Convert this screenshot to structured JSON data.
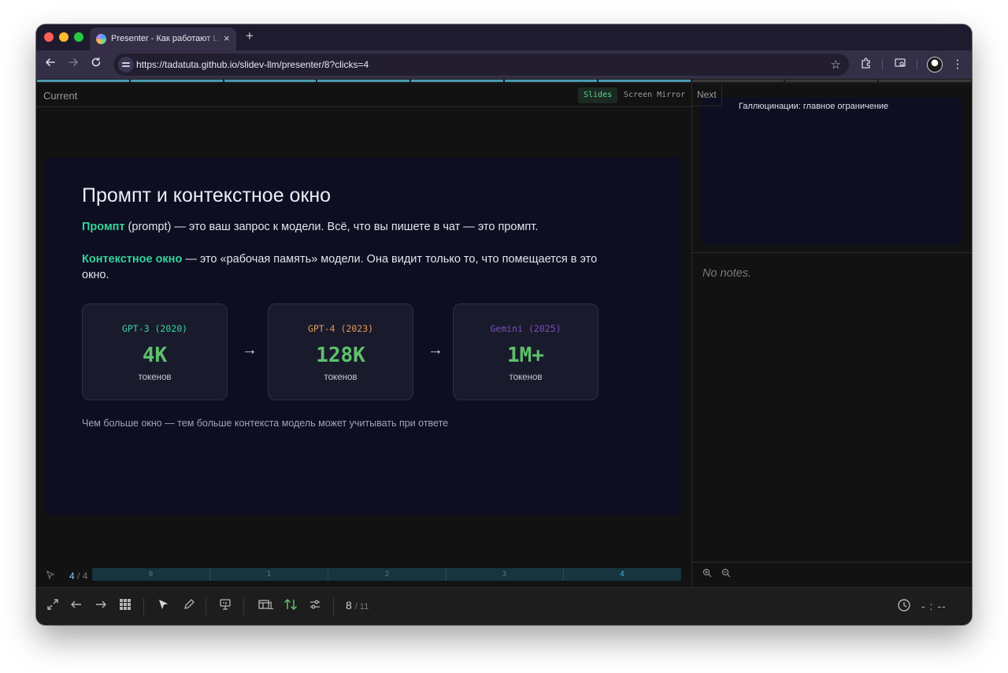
{
  "browser": {
    "tab": {
      "title": "Presenter - Как работают LLM",
      "close": "×"
    },
    "new_tab": "+",
    "url": "https://tadatuta.github.io/slidev-llm/presenter/8?clicks=4",
    "icons": [
      "back-icon",
      "forward-icon",
      "reload-icon",
      "site-info-icon",
      "star-icon",
      "extensions-icon",
      "cast-icon",
      "profile-avatar",
      "menu-icon"
    ]
  },
  "progress": {
    "completed_segments": 7,
    "total_segments": 10
  },
  "presenter": {
    "current_label": "Current",
    "tabs": {
      "slides": "Slides",
      "mirror": "Screen Mirror"
    },
    "next_label": "Next",
    "notes": "No notes.",
    "clicks": {
      "current": "4",
      "total": "/ 4",
      "steps": [
        "0",
        "1",
        "2",
        "3",
        "4"
      ],
      "active_step": 4
    }
  },
  "slide": {
    "title": "Промпт и контекстное окно",
    "prompt_term": "Промпт",
    "prompt_text": " (prompt) — это ваш запрос к модели. Всё, что вы пишете в чат — это промпт.",
    "context_term": "Контекстное окно",
    "context_text": " — это «рабочая память» модели. Она видит только то, что помещается в это окно.",
    "cards": [
      {
        "model": "GPT-3 (2020)",
        "value": "4K",
        "unit": "токенов",
        "color": "#35d49a"
      },
      {
        "model": "GPT-4 (2023)",
        "value": "128K",
        "unit": "токенов",
        "color": "#e19a52"
      },
      {
        "model": "Gemini (2025)",
        "value": "1M+",
        "unit": "токенов",
        "color": "#7a4fb8"
      }
    ],
    "arrow": "→",
    "footnote": "Чем больше окно — тем больше контекста модель может учитывать при ответе"
  },
  "next_slide": {
    "title": "Галлюцинации: главное ограничение"
  },
  "bottom": {
    "slide_number": "8",
    "slide_total": "/ 11",
    "layout_count": "1",
    "timer": "- : --"
  },
  "colors": {
    "accent_green": "#35d49a",
    "value_green": "#5fc06d",
    "progress": "#4a9ab0",
    "slide_bg": "#0d0e21"
  }
}
